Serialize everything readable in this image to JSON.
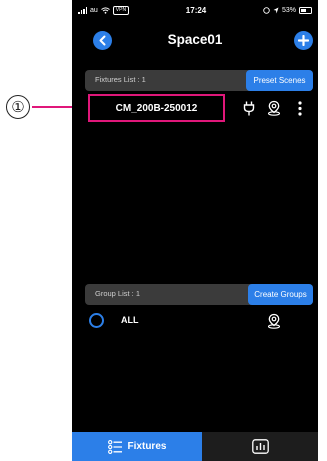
{
  "callout": {
    "number": "①"
  },
  "status_bar": {
    "carrier": "au",
    "vpn": "VPN",
    "time": "17:24",
    "battery": "53%"
  },
  "nav": {
    "title": "Space01"
  },
  "fixtures_section": {
    "header_label": "Fixtures List : 1",
    "action_label": "Preset Scenes",
    "items": [
      {
        "name": "CM_200B-250012"
      }
    ]
  },
  "groups_section": {
    "header_label": "Group List : 1",
    "action_label": "Create Groups",
    "items": [
      {
        "name": "ALL"
      }
    ]
  },
  "tabs": {
    "fixtures_label": "Fixtures"
  },
  "colors": {
    "accent": "#2c7fe8",
    "highlight": "#e0177a",
    "background": "#000000",
    "section_header": "#3b3b3b"
  }
}
